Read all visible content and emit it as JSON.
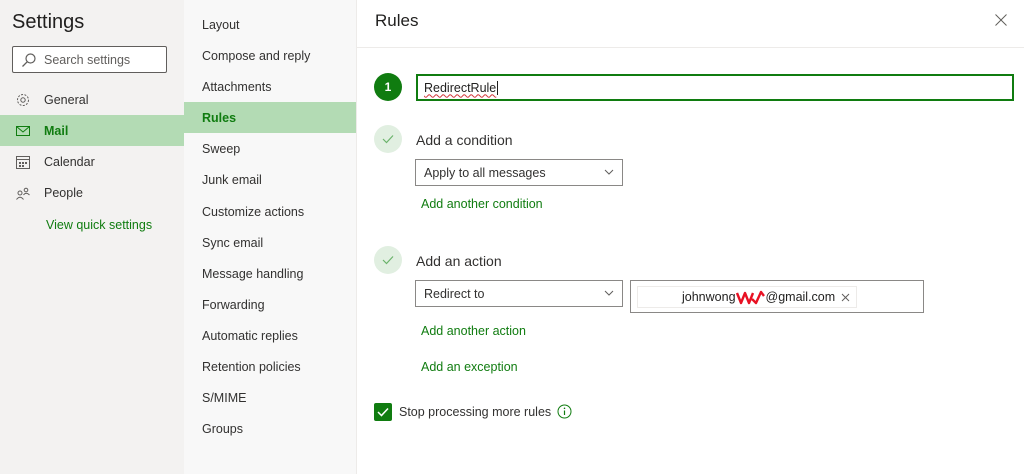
{
  "left_nav": {
    "title": "Settings",
    "search_placeholder": "Search settings",
    "items": [
      {
        "label": "General",
        "icon": "gear-icon"
      },
      {
        "label": "Mail",
        "icon": "mail-icon"
      },
      {
        "label": "Calendar",
        "icon": "calendar-icon"
      },
      {
        "label": "People",
        "icon": "people-icon"
      }
    ],
    "selected": "Mail",
    "quick_settings_label": "View quick settings"
  },
  "mail_nav": {
    "items": [
      "Layout",
      "Compose and reply",
      "Attachments",
      "Rules",
      "Sweep",
      "Junk email",
      "Customize actions",
      "Sync email",
      "Message handling",
      "Forwarding",
      "Automatic replies",
      "Retention policies",
      "S/MIME",
      "Groups"
    ],
    "selected": "Rules"
  },
  "rules": {
    "title": "Rules",
    "step1_number": "1",
    "rule_name": "RedirectRule",
    "condition_label": "Add a condition",
    "condition_value": "Apply to all messages",
    "add_condition_link": "Add another condition",
    "action_label": "Add an action",
    "action_value": "Redirect to",
    "recipient_prefix": "johnwong",
    "recipient_suffix": "@gmail.com",
    "add_action_link": "Add another action",
    "add_exception_link": "Add an exception",
    "stop_processing_label": "Stop processing more rules",
    "stop_processing_checked": true
  },
  "colors": {
    "accent": "#107c10",
    "selected_bg": "#b3dbb4",
    "nav_bg": "#f3f2f1"
  }
}
